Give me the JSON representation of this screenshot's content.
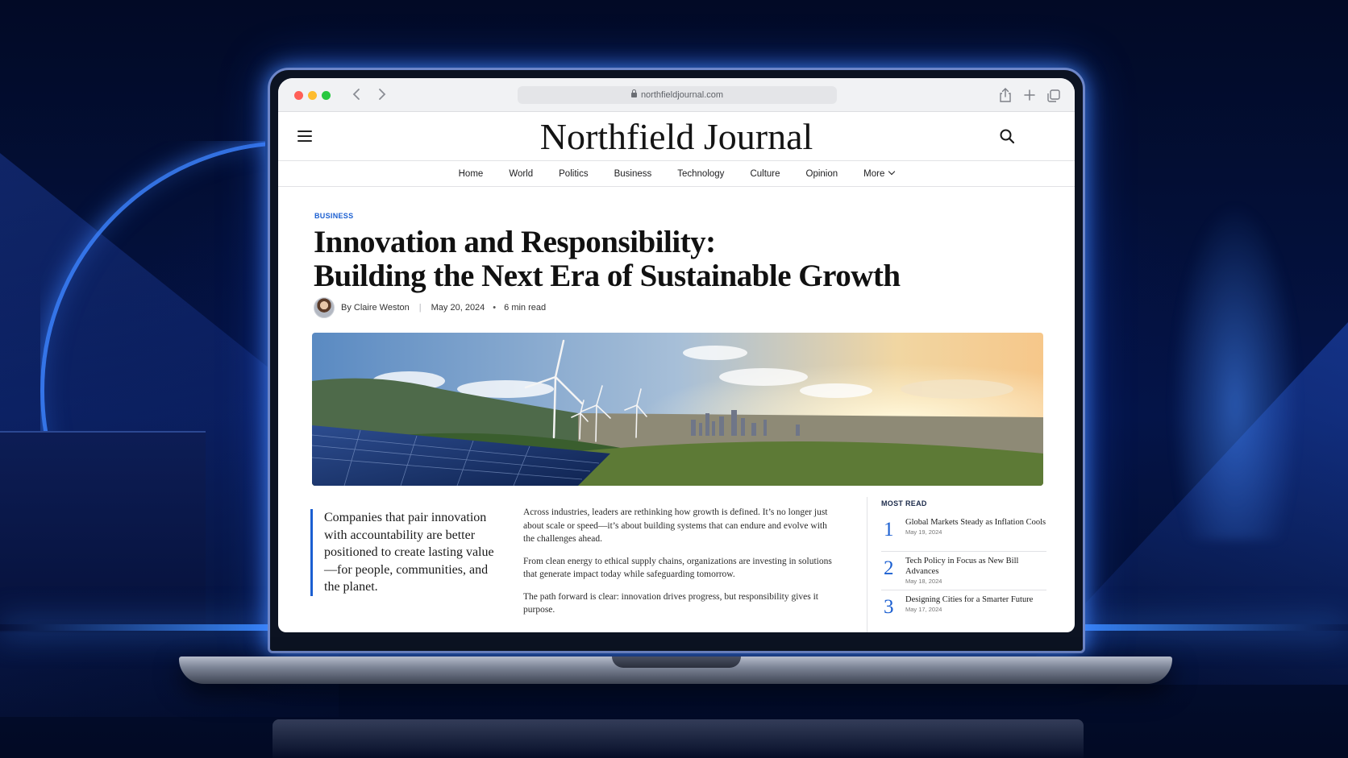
{
  "browser": {
    "url": "northfieldjournal.com"
  },
  "site": {
    "title": "Northfield Journal"
  },
  "nav": {
    "items": [
      "Home",
      "World",
      "Politics",
      "Business",
      "Technology",
      "Culture",
      "Opinion",
      "More"
    ]
  },
  "article": {
    "kicker": "BUSINESS",
    "headline_line1": "Innovation and Responsibility:",
    "headline_line2": "Building the Next Era of Sustainable Growth",
    "author": "By Claire Weston",
    "date": "May 20, 2024",
    "read_time": "6 min read",
    "pull_quote": "Companies that pair innovation with accountability are better positioned to create lasting value—for people, communities, and the planet.",
    "paragraphs": [
      "Across industries, leaders are rethinking how growth is defined. It’s no longer just about scale or speed—it’s about building systems that can endure and evolve with the challenges ahead.",
      "From clean energy to ethical supply chains, organizations are investing in solutions that generate impact today while safeguarding tomorrow.",
      "The path forward is clear: innovation drives progress, but responsibility gives it purpose."
    ]
  },
  "most_read": {
    "title": "MOST READ",
    "items": [
      {
        "rank": "1",
        "headline": "Global Markets Steady as Inflation Cools",
        "date": "May 19, 2024"
      },
      {
        "rank": "2",
        "headline": "Tech Policy in Focus as New Bill Advances",
        "date": "May 18, 2024"
      },
      {
        "rank": "3",
        "headline": "Designing Cities for a Smarter Future",
        "date": "May 17, 2024"
      }
    ]
  },
  "colors": {
    "accent": "#1b5fd1",
    "background": "#020a24",
    "glow": "#3c8cff"
  },
  "icons": [
    "menu-icon",
    "search-icon",
    "share-icon",
    "new-tab-icon",
    "tabs-icon",
    "back-icon",
    "forward-icon",
    "lock-icon",
    "chevron-down-icon"
  ]
}
